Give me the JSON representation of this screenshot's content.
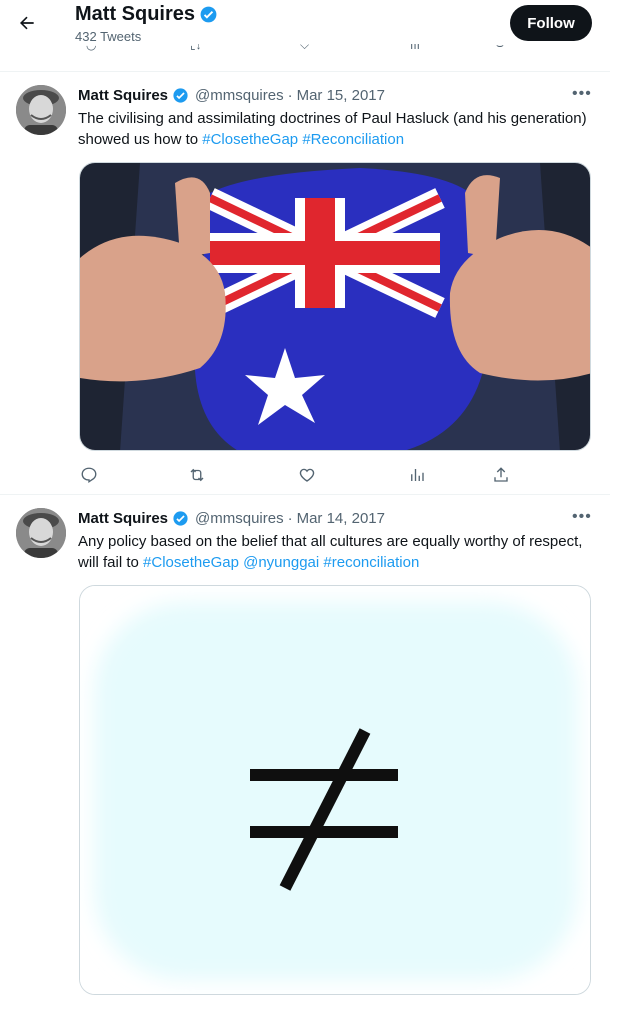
{
  "header": {
    "back_icon": "arrow-left-icon",
    "name": "Matt Squires",
    "tweet_count": "432 Tweets",
    "follow_label": "Follow",
    "verified_icon": "verified-badge-icon"
  },
  "colors": {
    "link": "#1d9bf0",
    "verified": "#1d9bf0",
    "text": "#0f1419",
    "muted": "#536471",
    "button": "#0f1419"
  },
  "tweets": [
    {
      "name": "Matt Squires",
      "handle": "@mmsquires",
      "date": "Mar 15, 2017",
      "text_parts": [
        "The civilising and assimilating doctrines of Paul Hasluck (and his generation) showed us how to ",
        "#ClosetheGap",
        " ",
        "#Reconciliation"
      ],
      "media": "australian-flag-shirt-image",
      "actions": [
        "reply-icon",
        "retweet-icon",
        "like-icon",
        "views-icon",
        "share-icon"
      ]
    },
    {
      "name": "Matt Squires",
      "handle": "@mmsquires",
      "date": "Mar 14, 2017",
      "text_parts": [
        "Any policy based on the belief that all cultures are equally worthy of respect, will fail to ",
        "#ClosetheGap",
        " ",
        "@nyunggai",
        " ",
        "#reconciliation"
      ],
      "media": "not-equal-sign-image"
    }
  ]
}
